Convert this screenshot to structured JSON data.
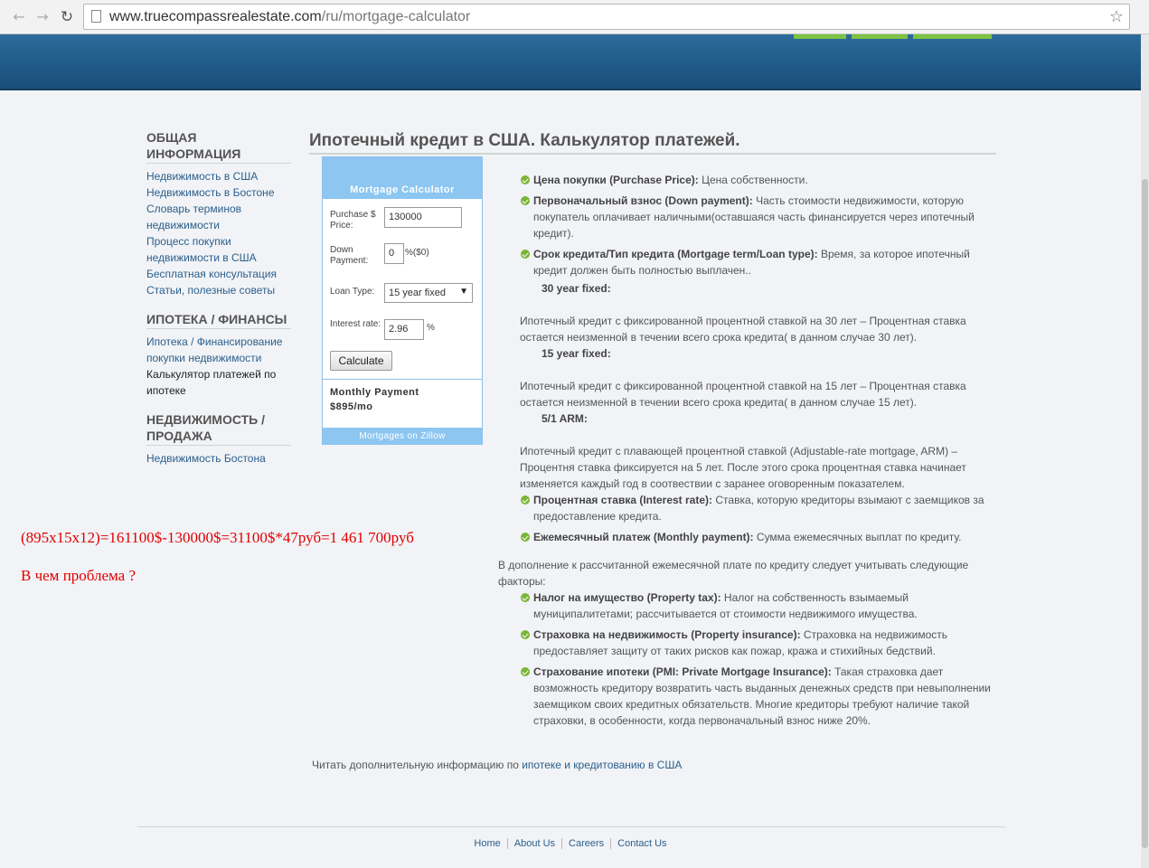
{
  "browser": {
    "url_host": "www.truecompassrealestate.com",
    "url_path": "/ru/mortgage-calculator"
  },
  "nav": [
    {
      "heading": "ОБЩАЯ ИНФОРМАЦИЯ",
      "links": [
        "Недвижимость в США",
        "Недвижимость в Бостоне",
        "Словарь терминов недвижимости",
        "Процесс покупки недвижимости в США",
        "Бесплатная консультация",
        "Статьи, полезные советы"
      ]
    },
    {
      "heading": "ИПОТЕКА / ФИНАНСЫ",
      "links": [
        "Ипотека / Финансирование покупки недвижимости",
        "Калькулятор платежей по ипотеке"
      ]
    },
    {
      "heading": "НЕДВИЖИМОСТЬ / ПРОДАЖА",
      "links": [
        "Недвижимость Бостона"
      ]
    }
  ],
  "note": {
    "line1": "(895x15x12)=161100$-130000$=31100$*47руб=1 461 700руб",
    "line2": "В чем проблема ?"
  },
  "title": "Ипотечный кредит в США. Калькулятор платежей.",
  "calculator": {
    "title": "Mortgage Calculator",
    "price_label": "Purchase $ Price:",
    "price_value": "130000",
    "down_label": "Down Payment:",
    "down_value": "0",
    "down_suffix": "%($0)",
    "loan_label": "Loan Type:",
    "loan_value": "15 year fixed",
    "rate_label": "Interest rate:",
    "rate_value": "2.96",
    "rate_suffix": "%",
    "button": "Calculate",
    "result_label": "Monthly Payment",
    "result_value": "$895/mo",
    "footer": "Mortgages on Zillow"
  },
  "content": {
    "b1_term": "Цена покупки (Purchase Price):",
    "b1_text": " Цена собственности.",
    "b2_term": "Первоначальный взнос (Down payment):",
    "b2_text": " Часть стоимости недвижимости, которую покупатель оплачивает наличными(оставшаяся часть финансируется через ипотечный кредит).",
    "b3_term": "Срок кредита/Тип кредита (Mortgage term/Loan type):",
    "b3_text": " Время, за которое ипотечный кредит должен быть полностью выплачен..",
    "h30": "30 year fixed:",
    "p30": "Ипотечный кредит с фиксированной процентной ставкой на 30 лет – Процентная ставка остается неизменной в течении всего срока кредита( в данном случае 30 лет).",
    "h15": "15 year fixed:",
    "p15": "Ипотечный кредит с фиксированной процентной ставкой на 15 лет – Процентная ставка остается неизменной в течении всего срока кредита( в данном случае 15 лет).",
    "harm": "5/1 ARM:",
    "parm": "Ипотечный кредит с плавающей процентной ставкой (Adjustable-rate mortgage, ARM) – Процентня ставка фиксируется на 5 лет. После этого срока процентная ставка начинает изменяется каждый год в соотвествии с заранее оговоренным показателем.",
    "b4_term": "Процентная ставка (Interest rate):",
    "b4_text": " Ставка, которую кредиторы взымают с заемщиков за предоставление кредита.",
    "b5_term": "Ежемесячный платеж (Monthly payment):",
    "b5_text": " Сумма ежемесячных выплат по кредиту.",
    "intro": "В дополнение к рассчитанной ежемесячной плате по кредиту следует учитывать следующие факторы:",
    "b6_term": "Налог на имущество (Property tax):",
    "b6_text": " Налог на собственность взымаемый муниципалитетами; рассчитывается от стоимости недвижимого имущества.",
    "b7_term": "Страховка на недвижимость (Property insurance):",
    "b7_text": " Страховка на недвижимость предоставляет защиту от таких рисков как пожар, кража и стихийных бедствий.",
    "b8_term": "Страхование ипотеки (PMI: Private Mortgage Insurance):",
    "b8_text": " Такая страховка дает возможность кредитору возвратить часть выданных денежных средств при невыполнении заемщиком своих кредитных обязательств. Многие кредиторы требуют наличие такой страховки, в особенности, когда первоначальный взнос ниже 20%.",
    "more_text": "Читать дополнительную информацию по ",
    "more_link": "ипотеке и кредитованию в США"
  },
  "footer": [
    "Home",
    "About Us",
    "Careers",
    "Contact Us"
  ],
  "colors": {
    "header": "#1f5a87",
    "accent": "#7dc242",
    "link": "#2b5f8c",
    "note": "#e00000"
  }
}
